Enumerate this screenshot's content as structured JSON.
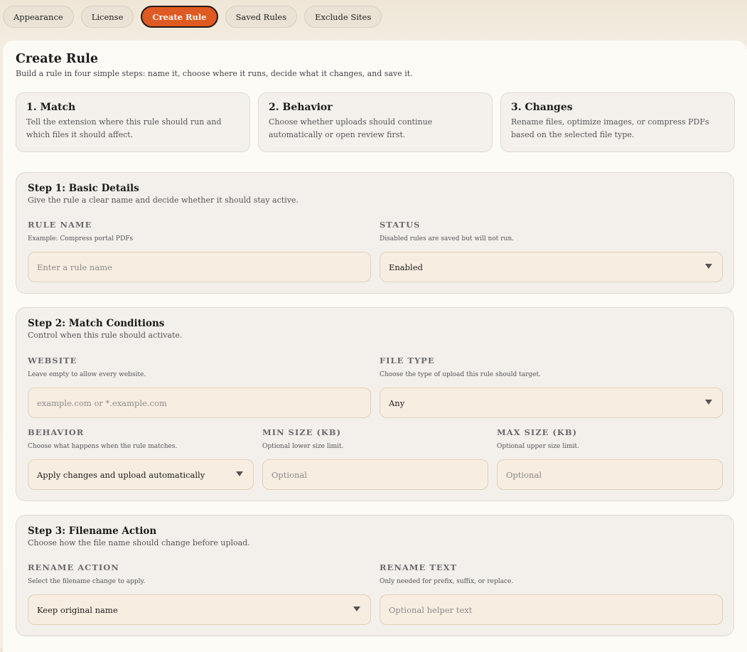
{
  "tabs": [
    {
      "label": "Appearance",
      "active": false
    },
    {
      "label": "License",
      "active": false
    },
    {
      "label": "Create Rule",
      "active": true
    },
    {
      "label": "Saved Rules",
      "active": false
    },
    {
      "label": "Exclude Sites",
      "active": false
    }
  ],
  "page": {
    "title": "Create Rule",
    "subtitle": "Build a rule in four simple steps: name it, choose where it runs, decide what it changes, and save it."
  },
  "cards": [
    {
      "title": "1. Match",
      "desc": "Tell the extension where this rule should run and which files it should affect."
    },
    {
      "title": "2. Behavior",
      "desc": "Choose whether uploads should continue automatically or open review first."
    },
    {
      "title": "3. Changes",
      "desc": "Rename files, optimize images, or compress PDFs based on the selected file type."
    }
  ],
  "step1": {
    "title": "Step 1: Basic Details",
    "subtitle": "Give the rule a clear name and decide whether it should stay active.",
    "rule_name": {
      "label": "RULE NAME",
      "hint": "Example: Compress portal PDFs",
      "placeholder": "Enter a rule name",
      "value": ""
    },
    "status": {
      "label": "STATUS",
      "hint": "Disabled rules are saved but will not run.",
      "value": "Enabled"
    }
  },
  "step2": {
    "title": "Step 2: Match Conditions",
    "subtitle": "Control when this rule should activate.",
    "website": {
      "label": "WEBSITE",
      "hint": "Leave empty to allow every website.",
      "placeholder": "example.com or *.example.com",
      "value": ""
    },
    "file_type": {
      "label": "FILE TYPE",
      "hint": "Choose the type of upload this rule should target.",
      "value": "Any"
    },
    "behavior": {
      "label": "BEHAVIOR",
      "hint": "Choose what happens when the rule matches.",
      "value": "Apply changes and upload automatically"
    },
    "min_size": {
      "label": "MIN SIZE (KB)",
      "hint": "Optional lower size limit.",
      "placeholder": "Optional",
      "value": ""
    },
    "max_size": {
      "label": "MAX SIZE (KB)",
      "hint": "Optional upper size limit.",
      "placeholder": "Optional",
      "value": ""
    }
  },
  "step3": {
    "title": "Step 3: Filename Action",
    "subtitle": "Choose how the file name should change before upload.",
    "rename_action": {
      "label": "RENAME ACTION",
      "hint": "Select the filename change to apply.",
      "value": "Keep original name"
    },
    "rename_text": {
      "label": "RENAME TEXT",
      "hint": "Only needed for prefix, suffix, or replace.",
      "placeholder": "Optional helper text",
      "value": ""
    }
  },
  "colors": {
    "accent": "#de5a22",
    "input_bg": "#f8ede1",
    "section_bg": "#f3f0eb"
  },
  "icons": {
    "select_caret": "chevron-down-icon"
  }
}
